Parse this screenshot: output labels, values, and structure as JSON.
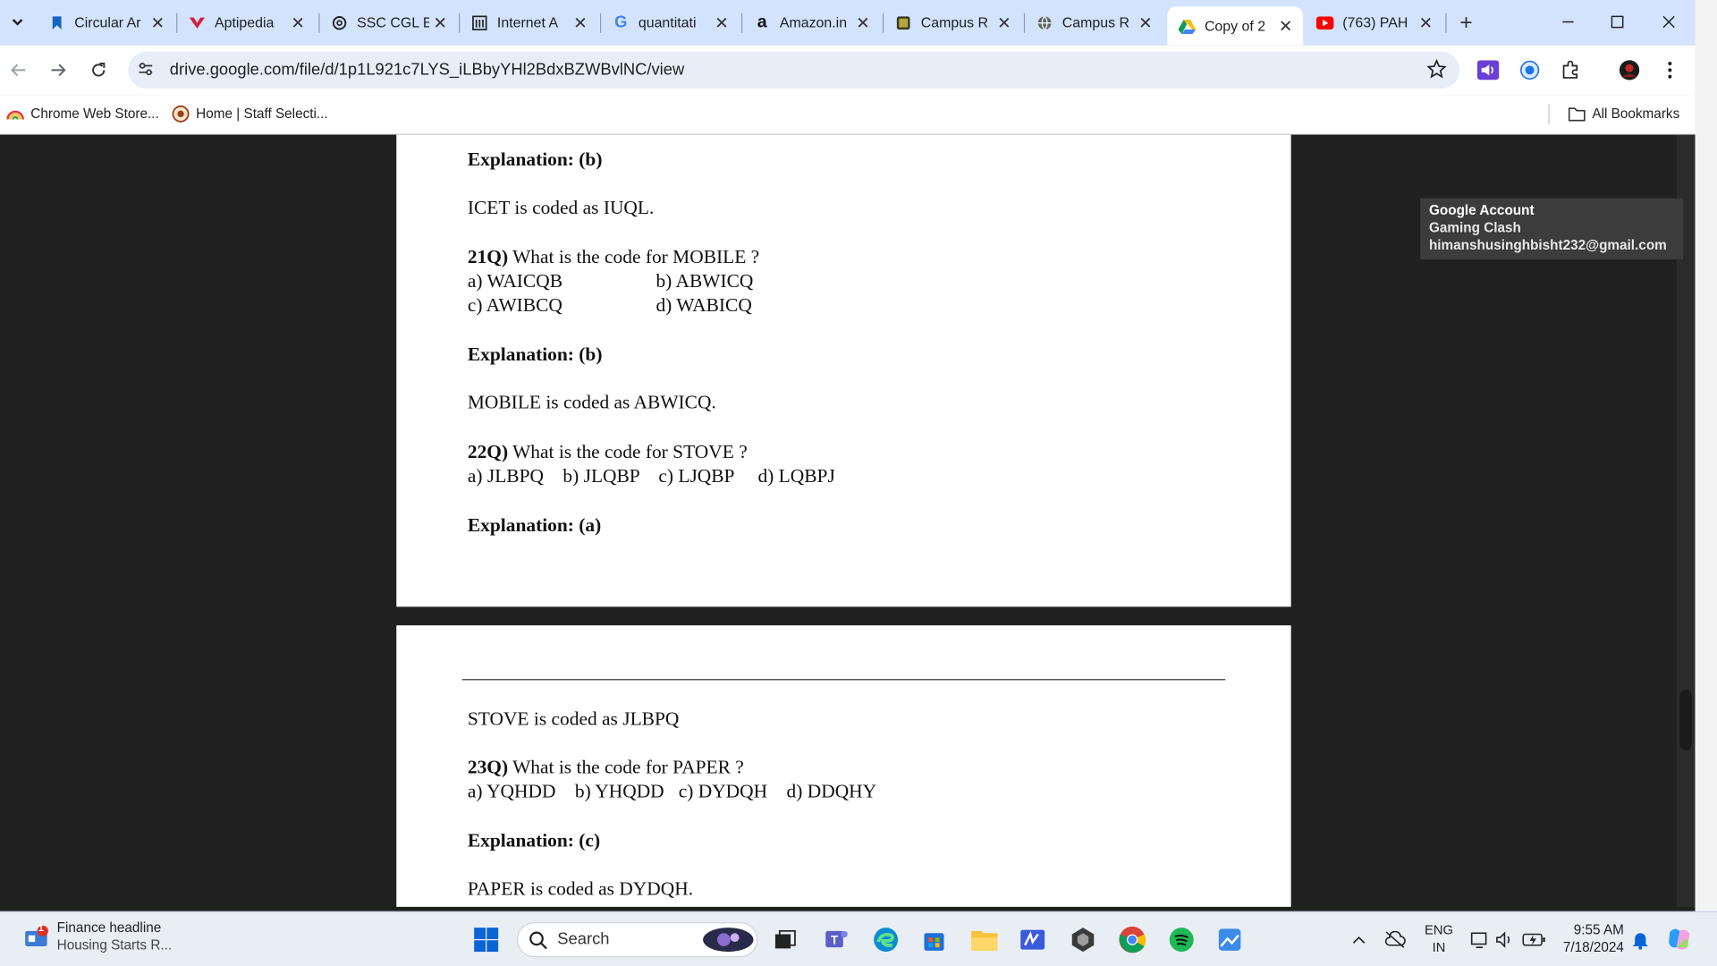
{
  "tabs": [
    {
      "title": "Circular Ar",
      "icon": "bookmark-blue"
    },
    {
      "title": "Aptipedia",
      "icon": "aptipedia"
    },
    {
      "title": "SSC CGL E",
      "icon": "openai"
    },
    {
      "title": "Internet A",
      "icon": "archive"
    },
    {
      "title": "quantitati",
      "icon": "google"
    },
    {
      "title": "Amazon.in",
      "icon": "amazon"
    },
    {
      "title": "Campus R",
      "icon": "campus"
    },
    {
      "title": "Campus R",
      "icon": "globe"
    },
    {
      "title": "Copy of 2",
      "icon": "drive",
      "active": true
    },
    {
      "title": "(763) PAH",
      "icon": "youtube"
    }
  ],
  "address": {
    "url": "drive.google.com/file/d/1p1L921c7LYS_iLBbyYHl2BdxBZWBvlNC/view"
  },
  "bookmarks": [
    {
      "label": "Chrome Web Store...",
      "icon": "rainbow"
    },
    {
      "label": "Home | Staff Selecti...",
      "icon": "ssc-emblem"
    }
  ],
  "all_bookmarks": "All Bookmarks",
  "tooltip": {
    "title": "Google Account",
    "name": "Gaming Clash",
    "email": "himanshusinghbisht232@gmail.com"
  },
  "page1": {
    "exp20": "Explanation: (b)",
    "ans20": "ICET is coded as IUQL.",
    "q21_num": "21Q)",
    "q21_text": " What is the code for MOBILE ?",
    "q21_a": "a) WAICQB",
    "q21_b": "b) ABWICQ",
    "q21_c": "c) AWIBCQ",
    "q21_d": "d) WABICQ",
    "exp21": "Explanation: (b)",
    "ans21": "MOBILE is coded as ABWICQ.",
    "q22_num": "22Q)",
    "q22_text": " What is the code for STOVE ?",
    "q22_opts": "a) JLBPQ    b) JLQBP    c) LJQBP     d) LQBPJ",
    "exp22": "Explanation: (a)"
  },
  "page2": {
    "ans22": "STOVE is coded as JLBPQ",
    "q23_num": "23Q)",
    "q23_text": " What is the code for PAPER ?",
    "q23_opts": "a) YQHDD    b) YHQDD   c) DYDQH    d) DDQHY",
    "exp23": "Explanation: (c)",
    "ans23": "PAPER is coded as DYDQH."
  },
  "taskbar": {
    "news_title": "Finance headline",
    "news_sub": "Housing Starts R...",
    "news_badge": "1",
    "search": "Search",
    "lang1": "ENG",
    "lang2": "IN",
    "time": "9:55 AM",
    "date": "7/18/2024"
  },
  "colors": {
    "tabstrip": "#d3e3fd",
    "viewer_bg": "#202020",
    "taskbar": "#e9eef5"
  }
}
